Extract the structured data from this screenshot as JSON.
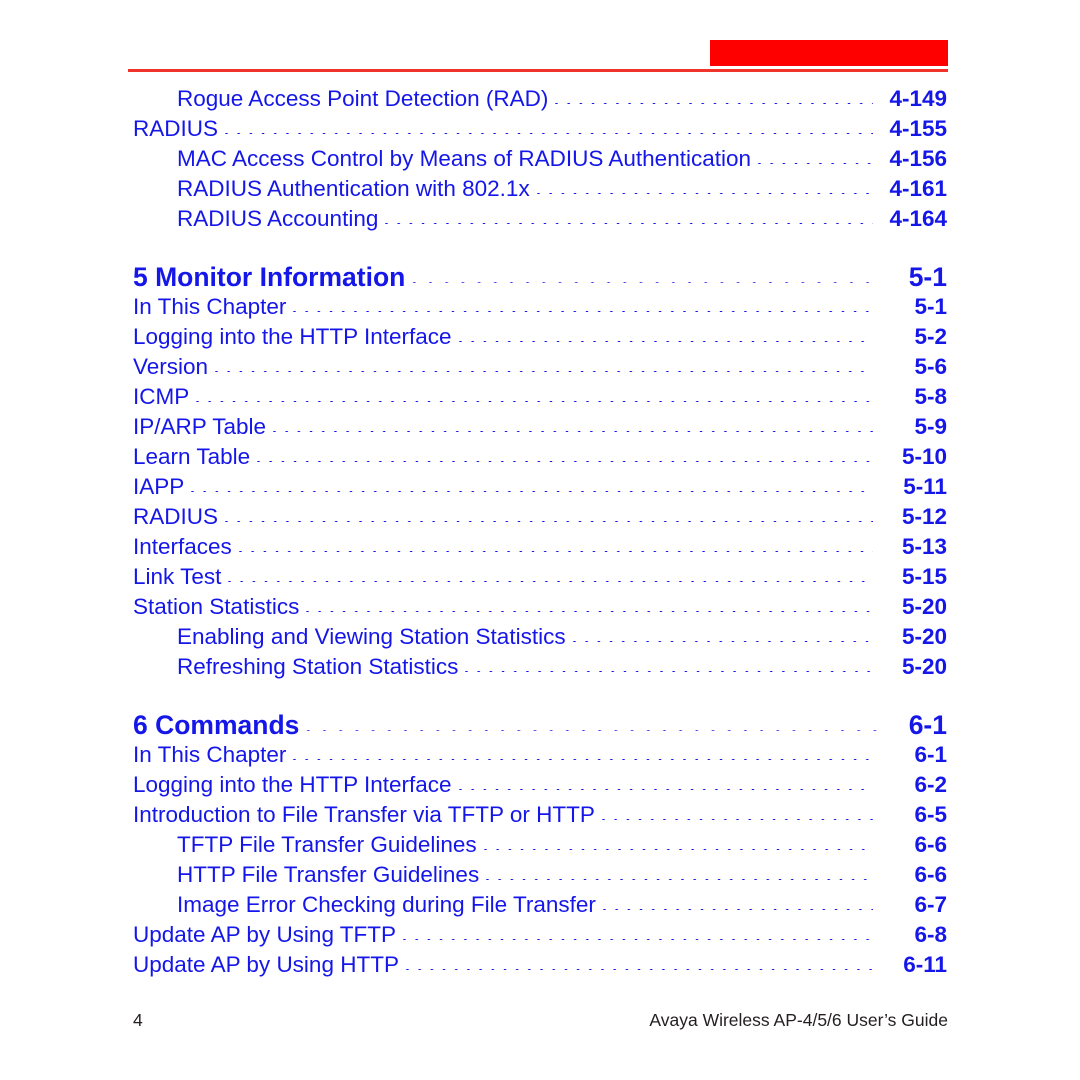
{
  "document": {
    "type": "table-of-contents",
    "accent_color": "#ff0000",
    "rule_color": "#f0342c",
    "text_color": "#1516e8",
    "footer_color": "#231f20"
  },
  "toc": {
    "entries": [
      {
        "level": 2,
        "title": "Rogue Access Point Detection (RAD)",
        "page": "4-149"
      },
      {
        "level": 1,
        "title": "RADIUS",
        "page": "4-155"
      },
      {
        "level": 2,
        "title": "MAC Access Control by Means of RADIUS Authentication",
        "page": "4-156"
      },
      {
        "level": 2,
        "title": "RADIUS Authentication with 802.1x",
        "page": "4-161"
      },
      {
        "level": 2,
        "title": "RADIUS Accounting",
        "page": "4-164"
      },
      {
        "level": 0,
        "title": "5 Monitor Information",
        "page": "5-1"
      },
      {
        "level": 1,
        "title": "In This Chapter",
        "page": "5-1"
      },
      {
        "level": 1,
        "title": "Logging into the HTTP Interface",
        "page": "5-2"
      },
      {
        "level": 1,
        "title": "Version",
        "page": "5-6"
      },
      {
        "level": 1,
        "title": "ICMP",
        "page": "5-8"
      },
      {
        "level": 1,
        "title": "IP/ARP Table",
        "page": "5-9"
      },
      {
        "level": 1,
        "title": "Learn Table",
        "page": "5-10"
      },
      {
        "level": 1,
        "title": "IAPP",
        "page": "5-11"
      },
      {
        "level": 1,
        "title": "RADIUS",
        "page": "5-12"
      },
      {
        "level": 1,
        "title": "Interfaces",
        "page": "5-13"
      },
      {
        "level": 1,
        "title": "Link Test",
        "page": "5-15"
      },
      {
        "level": 1,
        "title": "Station Statistics",
        "page": "5-20"
      },
      {
        "level": 2,
        "title": "Enabling and Viewing Station Statistics",
        "page": "5-20"
      },
      {
        "level": 2,
        "title": "Refreshing Station Statistics",
        "page": "5-20"
      },
      {
        "level": 0,
        "title": "6 Commands",
        "page": "6-1"
      },
      {
        "level": 1,
        "title": "In This Chapter",
        "page": "6-1"
      },
      {
        "level": 1,
        "title": "Logging into the HTTP Interface",
        "page": "6-2"
      },
      {
        "level": 1,
        "title": "Introduction to File Transfer via TFTP or HTTP",
        "page": "6-5"
      },
      {
        "level": 2,
        "title": "TFTP File Transfer Guidelines",
        "page": "6-6"
      },
      {
        "level": 2,
        "title": "HTTP File Transfer Guidelines",
        "page": "6-6"
      },
      {
        "level": 2,
        "title": "Image Error Checking during File Transfer",
        "page": "6-7"
      },
      {
        "level": 1,
        "title": "Update AP by Using TFTP",
        "page": "6-8"
      },
      {
        "level": 1,
        "title": "Update AP by Using HTTP",
        "page": "6-11"
      }
    ]
  },
  "footer": {
    "folio": "4",
    "guide": "Avaya Wireless AP-4/5/6 User’s Guide"
  }
}
